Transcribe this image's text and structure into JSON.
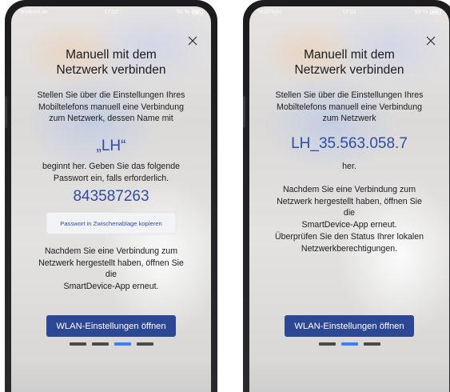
{
  "left_phone": {
    "status": {
      "carrier": "Telekom.de",
      "time": "17:52",
      "battery": "90 %"
    },
    "title_line1": "Manuell mit dem",
    "title_line2": "Netzwerk verbinden",
    "intro": [
      "Stellen Sie über die Einstellungen Ihres",
      "Mobiltelefons manuell eine Verbindung",
      "zum Netzwerk, dessen Name mit"
    ],
    "network_name": "„LH“",
    "middle": [
      "beginnt her. Geben Sie das folgende",
      "Passwort ein, falls erforderlich."
    ],
    "password": "843587263",
    "copy_button": "Passwort in Zwischenablage kopieren",
    "outro": [
      "Nachdem Sie eine Verbindung zum",
      "Netzwerk hergestellt haben, öffnen Sie die",
      "SmartDevice-App erneut."
    ],
    "primary_button": "WLAN-Einstellungen öffnen",
    "pager": {
      "count": 4,
      "active_index": 2
    }
  },
  "right_phone": {
    "status": {
      "carrier": "TestFlight",
      "time": "17:31",
      "battery": "93 %"
    },
    "title_line1": "Manuell mit dem",
    "title_line2": "Netzwerk verbinden",
    "intro": [
      "Stellen Sie über die Einstellungen Ihres",
      "Mobiltelefons manuell eine Verbindung",
      "zum Netzwerk"
    ],
    "network_name": "LH_35.563.058.7",
    "middle": [
      "her."
    ],
    "outro": [
      "Nachdem Sie eine Verbindung zum",
      "Netzwerk hergestellt haben, öffnen Sie die",
      "SmartDevice-App erneut."
    ],
    "permissions_note": [
      "Überprüfen Sie den Status Ihrer lokalen",
      "Netzwerkberechtigungen."
    ],
    "primary_button": "WLAN-Einstellungen öffnen",
    "pager": {
      "count": 3,
      "active_index": 1
    }
  },
  "colors": {
    "accent_blue": "#2f4da3",
    "button_bg": "#2c4794",
    "pager_active": "#3d7ff0",
    "pager_inactive": "#4a4a4a"
  }
}
